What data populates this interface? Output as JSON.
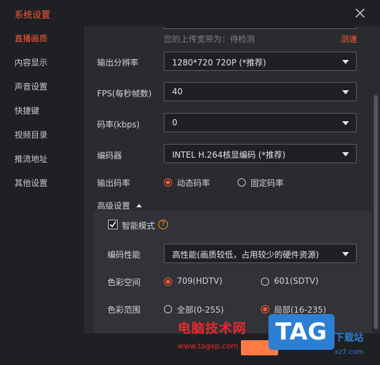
{
  "window": {
    "title": "系统设置"
  },
  "sidebar": {
    "items": [
      {
        "label": "直播画质",
        "active": true
      },
      {
        "label": "内容显示"
      },
      {
        "label": "声音设置"
      },
      {
        "label": "快捷键"
      },
      {
        "label": "视频目录"
      },
      {
        "label": "推流地址"
      },
      {
        "label": "其他设置"
      }
    ]
  },
  "upload": {
    "text": "您的上传宽带为：待检测",
    "test_label": "测速"
  },
  "output_resolution": {
    "label": "输出分辨率",
    "value": "1280*720 720P (*推荐)"
  },
  "fps": {
    "label": "FPS(每秒帧数)",
    "value": "40"
  },
  "bitrate": {
    "label": "码率(kbps)",
    "value": "0"
  },
  "encoder": {
    "label": "编码器",
    "value": "INTEL H.264核显编码 (*推荐)"
  },
  "output_rate": {
    "label": "输出码率",
    "options": [
      "动态码率",
      "固定码率"
    ],
    "selected": "动态码率"
  },
  "advanced": {
    "label": "高级设置",
    "smart_mode": {
      "label": "智能模式",
      "checked": true,
      "help": "?"
    },
    "encoding_performance": {
      "label": "编码性能",
      "value": "高性能(画质较低，占用较少的硬件资源)"
    },
    "color_space": {
      "label": "色彩空间",
      "options": [
        "709(HDTV)",
        "601(SDTV)"
      ],
      "selected": "709(HDTV)"
    },
    "color_range": {
      "label": "色彩范围",
      "options": [
        "全部(0-255)",
        "局部(16-235)"
      ],
      "selected": "局部(16-235)"
    }
  },
  "watermark": {
    "site_name": "电脑技术网",
    "site_url": "www.tagxp.com",
    "logo_text": "TAG",
    "side_text": "下载站",
    "side_url": "xz7.com"
  },
  "colors": {
    "accent": "#ff5a36",
    "bg": "#1f2023",
    "panel": "#2a2b2f"
  }
}
